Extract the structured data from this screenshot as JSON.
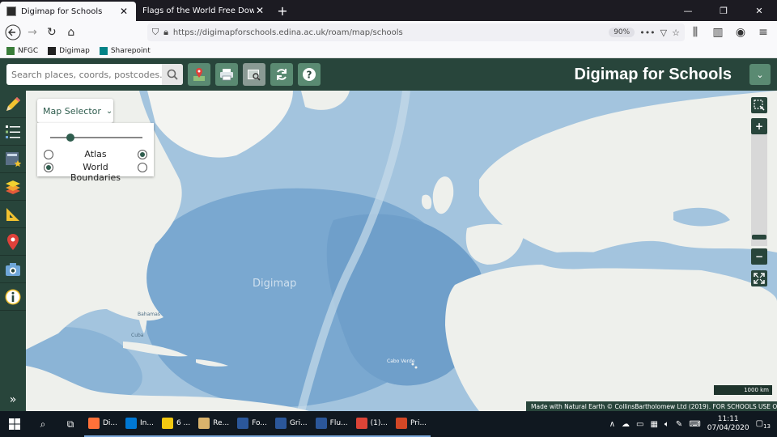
{
  "browser": {
    "tabs": [
      {
        "title": "Digimap for Schools",
        "active": true
      },
      {
        "title": "Flags of the World Free Download |",
        "active": false
      }
    ],
    "url": "https://digimapforschools.edina.ac.uk/roam/map/schools",
    "zoom": "90%",
    "bookmarks": [
      "NFGC",
      "Digimap",
      "Sharepoint"
    ]
  },
  "app": {
    "brand": "Digimap for Schools",
    "search_placeholder": "Search places, coords, postcodes...",
    "map_selector": {
      "button_label": "Map Selector",
      "blend": 0.22,
      "layers": [
        {
          "label": "Atlas",
          "left_selected": false,
          "right_selected": true
        },
        {
          "label": "World Boundaries",
          "left_selected": true,
          "right_selected": false
        }
      ]
    },
    "map": {
      "ocean_label": "Digimap",
      "labels": [
        "Bahamas",
        "Cabo Verde",
        "Cuba"
      ]
    },
    "zoom": {
      "level": 0.94
    },
    "scale_label": "1000 km",
    "credits": "Made with Natural Earth © CollinsBartholomew Ltd (2019). FOR SCHOOLS USE ONLY"
  },
  "colors": {
    "header": "#28453b",
    "tool_button": "#5a8a72",
    "accent": "#2f5d4e"
  },
  "taskbar": {
    "apps": [
      {
        "label": "Di...",
        "color": "#ff7139"
      },
      {
        "label": "In...",
        "color": "#0078d4"
      },
      {
        "label": "6 ...",
        "color": "#f2c811"
      },
      {
        "label": "Re...",
        "color": "#d9b36c"
      },
      {
        "label": "Fo...",
        "color": "#2b579a"
      },
      {
        "label": "Gri...",
        "color": "#2b579a"
      },
      {
        "label": "Flu...",
        "color": "#2b579a"
      },
      {
        "label": "(1)...",
        "color": "#db4437"
      },
      {
        "label": "Pri...",
        "color": "#d24726"
      }
    ],
    "time": "11:11",
    "date": "07/04/2020",
    "notifications": "13"
  }
}
